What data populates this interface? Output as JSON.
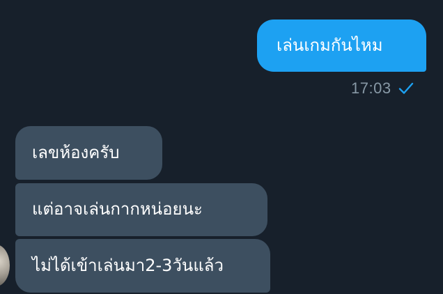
{
  "conversation": {
    "outgoing": [
      {
        "text": "เล่นเกมกันไหม",
        "time": "17:03",
        "status_icon": "check-icon"
      }
    ],
    "incoming": [
      {
        "text": "เลขห้องครับ"
      },
      {
        "text": "แต่อาจเล่นกากหน่อยนะ"
      },
      {
        "text": "ไม่ได้เข้าเล่นมา2-3วันแล้ว"
      }
    ]
  },
  "colors": {
    "background": "#17202b",
    "outgoing_bubble": "#1da1f2",
    "incoming_bubble": "#3d4f60",
    "timestamp": "#8899a6",
    "check": "#1da1f2"
  }
}
